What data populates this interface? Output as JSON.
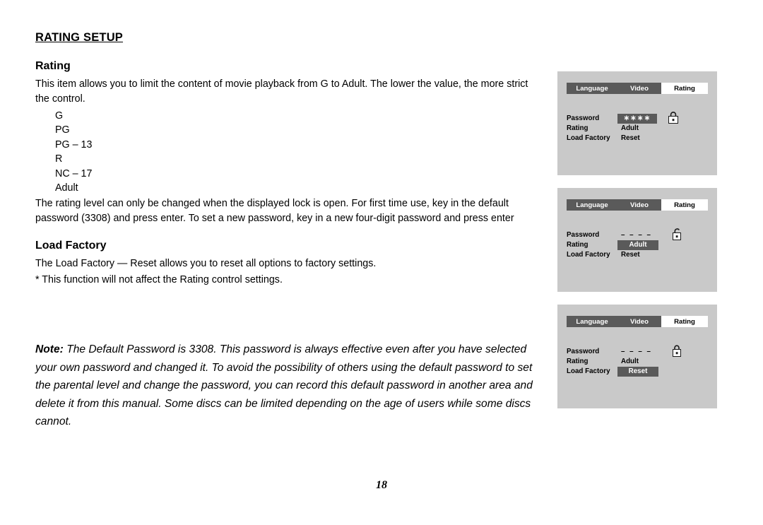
{
  "document": {
    "page_title": "RATING SETUP",
    "page_number": "18",
    "sections": [
      {
        "heading": "Rating",
        "paragraph": "This item allows you to limit the content of movie playback from G to Adult. The lower the value, the more strict the control.",
        "list": [
          "G",
          "PG",
          "PG – 13",
          "R",
          "NC – 17",
          "Adult"
        ],
        "paragraph2": "The rating level can only be changed when the displayed lock is open. For first time use, key in the default password (3308) and press enter. To set a new password, key in a new four-digit password and press enter"
      },
      {
        "heading": "Load Factory",
        "paragraph": "The Load Factory — Reset allows you to reset all options to factory settings.",
        "paragraph2": "* This function will not affect the Rating control settings."
      }
    ],
    "note": {
      "label": "Note:",
      "text": " The Default Password is 3308. This password is always effective even after you have selected your own password and changed it. To avoid  the possibility of others using the default password to set the parental level and change the password, you can record this default password in another area and delete it from this manual. Some discs can be limited depending on the age of users while some discs cannot."
    }
  },
  "osd_screens": [
    {
      "id": "screen-1",
      "tabs": [
        {
          "label": "Language",
          "active": false
        },
        {
          "label": "Video",
          "active": false
        },
        {
          "label": "Rating",
          "active": true
        }
      ],
      "rows": [
        {
          "label": "Password",
          "value": "∗∗∗∗",
          "style": "pw-stars",
          "lock": "locked"
        },
        {
          "label": "Rating",
          "value": "Adult",
          "style": "plain"
        },
        {
          "label": "Load Factory",
          "value": "Reset",
          "style": "plain"
        }
      ]
    },
    {
      "id": "screen-2",
      "tabs": [
        {
          "label": "Language",
          "active": false
        },
        {
          "label": "Video",
          "active": false
        },
        {
          "label": "Rating",
          "active": true
        }
      ],
      "rows": [
        {
          "label": "Password",
          "value": "– – – –",
          "style": "pw-dashes",
          "lock": "unlocked"
        },
        {
          "label": "Rating",
          "value": "Adult",
          "style": "selected"
        },
        {
          "label": "Load Factory",
          "value": "Reset",
          "style": "plain"
        }
      ]
    },
    {
      "id": "screen-3",
      "tabs": [
        {
          "label": "Language",
          "active": false
        },
        {
          "label": "Video",
          "active": false
        },
        {
          "label": "Rating",
          "active": true
        }
      ],
      "rows": [
        {
          "label": "Password",
          "value": "– – – –",
          "style": "pw-dashes",
          "lock": "locked"
        },
        {
          "label": "Rating",
          "value": "Adult",
          "style": "plain"
        },
        {
          "label": "Load Factory",
          "value": "Reset",
          "style": "selected"
        }
      ]
    }
  ],
  "colors": {
    "osd_background": "#c9c9c9",
    "osd_tab_inactive": "#5a5a5a",
    "osd_tab_active": "#ffffff",
    "osd_highlight": "#5a5a5a",
    "page_background": "#ffffff",
    "text": "#000000"
  }
}
